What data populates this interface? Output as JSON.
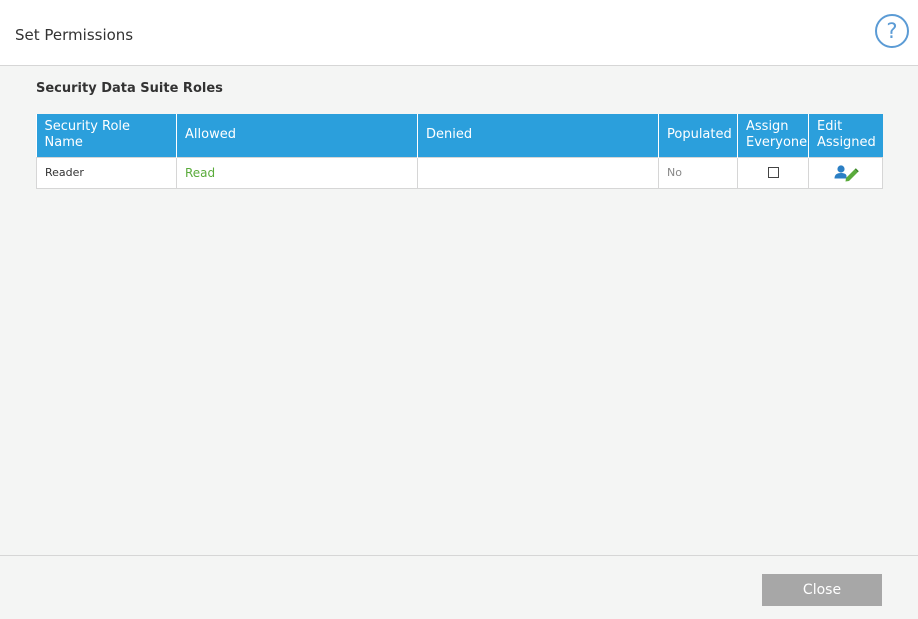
{
  "dialog": {
    "title": "Set Permissions",
    "help_label": "?"
  },
  "section": {
    "title": "Security Data Suite Roles"
  },
  "table": {
    "headers": {
      "role_name": "Security Role Name",
      "allowed": "Allowed",
      "denied": "Denied",
      "populated": "Populated",
      "assign_everyone": "Assign Everyone",
      "edit_assigned": "Edit Assigned"
    },
    "rows": [
      {
        "role_name": "Reader",
        "allowed": "Read",
        "denied": "",
        "populated": "No",
        "assign_everyone": false,
        "edit_icon": "user-edit-icon"
      }
    ]
  },
  "footer": {
    "close_label": "Close"
  },
  "colors": {
    "header_blue": "#2b9fdc",
    "allowed_green": "#5aab3b",
    "help_blue": "#5b9bd5",
    "close_gray": "#a7a7a7"
  }
}
